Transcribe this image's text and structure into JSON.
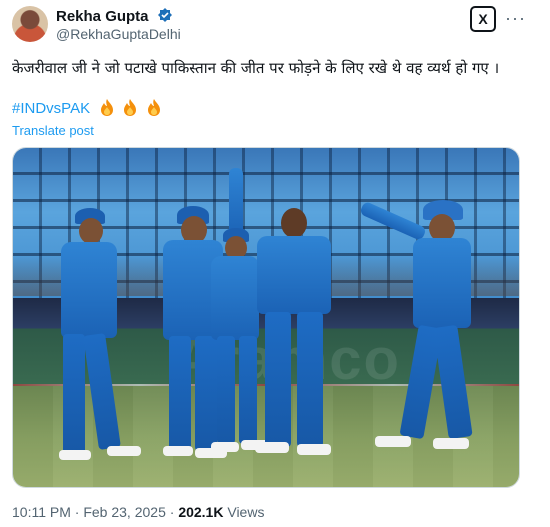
{
  "author": {
    "display_name": "Rekha Gupta",
    "handle": "@RekhaGuptaDelhi",
    "verified_icon": "verified-badge-icon"
  },
  "header": {
    "grok_icon": "x-grok-icon",
    "grok_label": "X",
    "more_icon": "more-options-icon",
    "more_label": "···"
  },
  "tweet": {
    "text": "केजरीवाल जी ने जो पटाखे पाकिस्तान की जीत पर फोड़ने के लिए रखे थे वह व्यर्थ हो गए ।",
    "hashtag": "#INDvsPAK",
    "emoji_icons": [
      "fire-icon",
      "fire-icon",
      "fire-icon"
    ],
    "translate": "Translate post"
  },
  "media": {
    "board_text": "Aramco"
  },
  "meta": {
    "time": "10:11 PM",
    "sep1": "·",
    "date": "Feb 23, 2025",
    "sep2": "·",
    "views_count": "202.1K",
    "views_label": "Views"
  },
  "colors": {
    "link": "#1d9bf0",
    "secondary_text": "#536471",
    "primary_text": "#0f1419",
    "verified": "#1d6fb8"
  }
}
